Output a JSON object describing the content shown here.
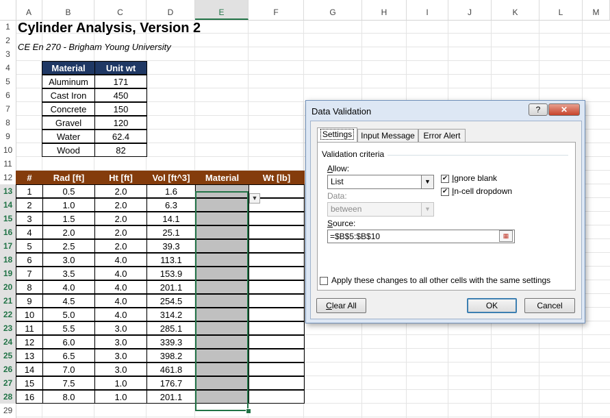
{
  "sheet": {
    "columns": [
      "A",
      "B",
      "C",
      "D",
      "E",
      "F",
      "G",
      "H",
      "I",
      "J",
      "K",
      "L",
      "M"
    ],
    "rows": [
      "1",
      "2",
      "3",
      "4",
      "5",
      "6",
      "7",
      "8",
      "9",
      "10",
      "11",
      "12",
      "13",
      "14",
      "15",
      "16",
      "17",
      "18",
      "19",
      "20",
      "21",
      "22",
      "23",
      "24",
      "25",
      "26",
      "27",
      "28",
      "29"
    ],
    "selected_column": "E",
    "title": "Cylinder Analysis, Version 2",
    "subtitle": "CE En 270 - Brigham Young University"
  },
  "materials_table": {
    "headers": [
      "Material",
      "Unit wt"
    ],
    "rows": [
      [
        "Aluminum",
        "171"
      ],
      [
        "Cast Iron",
        "450"
      ],
      [
        "Concrete",
        "150"
      ],
      [
        "Gravel",
        "120"
      ],
      [
        "Water",
        "62.4"
      ],
      [
        "Wood",
        "82"
      ]
    ]
  },
  "data_table": {
    "headers": [
      "#",
      "Rad [ft]",
      "Ht [ft]",
      "Vol [ft^3]",
      "Material",
      "Wt [lb]"
    ],
    "rows": [
      [
        "1",
        "0.5",
        "2.0",
        "1.6"
      ],
      [
        "2",
        "1.0",
        "2.0",
        "6.3"
      ],
      [
        "3",
        "1.5",
        "2.0",
        "14.1"
      ],
      [
        "4",
        "2.0",
        "2.0",
        "25.1"
      ],
      [
        "5",
        "2.5",
        "2.0",
        "39.3"
      ],
      [
        "6",
        "3.0",
        "4.0",
        "113.1"
      ],
      [
        "7",
        "3.5",
        "4.0",
        "153.9"
      ],
      [
        "8",
        "4.0",
        "4.0",
        "201.1"
      ],
      [
        "9",
        "4.5",
        "4.0",
        "254.5"
      ],
      [
        "10",
        "5.0",
        "4.0",
        "314.2"
      ],
      [
        "11",
        "5.5",
        "3.0",
        "285.1"
      ],
      [
        "12",
        "6.0",
        "3.0",
        "339.3"
      ],
      [
        "13",
        "6.5",
        "3.0",
        "398.2"
      ],
      [
        "14",
        "7.0",
        "3.0",
        "461.8"
      ],
      [
        "15",
        "7.5",
        "1.0",
        "176.7"
      ],
      [
        "16",
        "8.0",
        "1.0",
        "201.1"
      ]
    ]
  },
  "dialog": {
    "title": "Data Validation",
    "help_label": "?",
    "close_label": "✕",
    "tabs": [
      "Settings",
      "Input Message",
      "Error Alert"
    ],
    "criteria_label": "Validation criteria",
    "allow_label": "Allow:",
    "allow_value": "List",
    "data_label": "Data:",
    "data_value": "between",
    "ignore_blank_label": "Ignore blank",
    "incell_dropdown_label": "In-cell dropdown",
    "source_label": "Source:",
    "source_value": "=$B$5:$B$10",
    "apply_all_label": "Apply these changes to all other cells with the same settings",
    "clear_all_label": "Clear All",
    "ok_label": "OK",
    "cancel_label": "Cancel"
  },
  "icons": [
    "dropdown-arrow-icon",
    "checkmark-icon",
    "range-selector-icon",
    "close-icon",
    "help-icon"
  ],
  "colors": {
    "materials_header": "#1f3864",
    "data_header": "#843c0c",
    "material_cell_fill": "#c0c0c0",
    "selection": "#217346",
    "dialog_frame": "#dde7f4"
  }
}
